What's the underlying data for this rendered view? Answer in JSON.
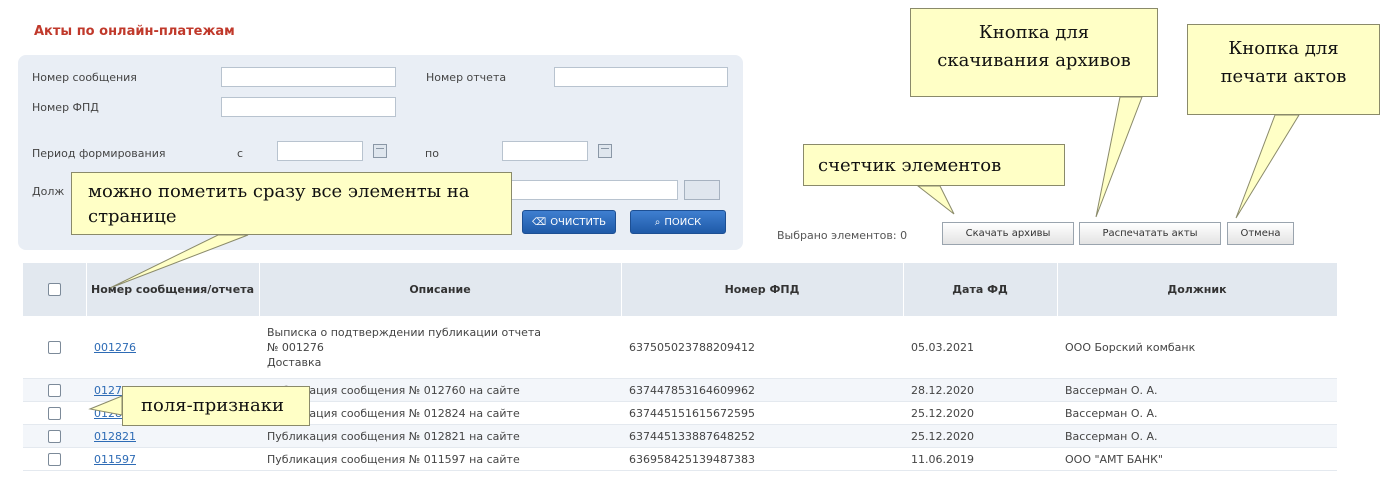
{
  "page": {
    "title": "Акты по онлайн-платежам"
  },
  "filters": {
    "message_number_label": "Номер сообщения",
    "report_number_label": "Номер отчета",
    "fpd_number_label": "Номер ФПД",
    "period_label": "Период формирования",
    "period_from": "с",
    "period_to": "по",
    "debtor_label_partial": "Долж",
    "clear_label": "очистить",
    "search_label": "поиск"
  },
  "toolbar": {
    "counter_text": "Выбрано элементов: 0",
    "download_label": "Скачать архивы",
    "print_label": "Распечатать акты",
    "cancel_label": "Отмена"
  },
  "table": {
    "columns": [
      "Номер сообщения/отчета",
      "Описание",
      "Номер ФПД",
      "Дата ФД",
      "Должник"
    ],
    "rows": [
      {
        "number": "001276",
        "description": [
          "Выписка о подтверждении публикации отчета",
          "№ 001276",
          "Доставка"
        ],
        "fpd": "637505023788209412",
        "date": "05.03.2021",
        "debtor": "ООО Борский комбанк"
      },
      {
        "number": "012760",
        "description": [
          "Публикация сообщения № 012760 на сайте"
        ],
        "fpd": "637447853164609962",
        "date": "28.12.2020",
        "debtor": "Вассерман О. А."
      },
      {
        "number": "012824",
        "description": [
          "Публикация сообщения № 012824 на сайте"
        ],
        "fpd": "637445151615672595",
        "date": "25.12.2020",
        "debtor": "Вассерман О. А."
      },
      {
        "number": "012821",
        "description": [
          "Публикация сообщения № 012821 на сайте"
        ],
        "fpd": "637445133887648252",
        "date": "25.12.2020",
        "debtor": "Вассерман О. А."
      },
      {
        "number": "011597",
        "description": [
          "Публикация сообщения № 011597 на сайте"
        ],
        "fpd": "636958425139487383",
        "date": "11.06.2019",
        "debtor": "ООО \"АМТ БАНК\""
      }
    ]
  },
  "callouts": {
    "download": "Кнопка для скачивания архивов",
    "print": "Кнопка для печати актов",
    "counter": "счетчик элементов",
    "select_all": "можно пометить сразу все элементы на странице",
    "flags": "поля-признаки"
  }
}
